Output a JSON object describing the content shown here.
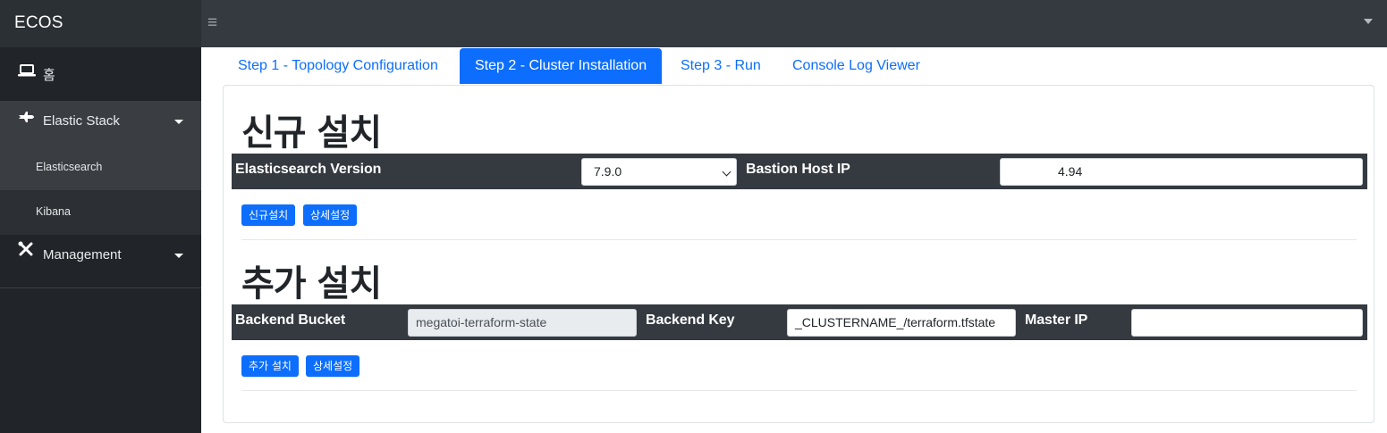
{
  "topbar": {
    "brand": "ECOS",
    "menu_icon": "hamburger-icon",
    "user_menu_icon": "caret-down-icon"
  },
  "sidebar": {
    "items": [
      {
        "label": "홈",
        "icon": "laptop-icon"
      },
      {
        "label": "Elastic Stack",
        "icon": "jet-icon",
        "expanded": true
      },
      {
        "label": "Elasticsearch",
        "icon": "",
        "active": true
      },
      {
        "label": "Kibana",
        "icon": ""
      },
      {
        "label": "Management",
        "icon": "tools-icon"
      }
    ]
  },
  "tabs": [
    {
      "label": "Step 1 - Topology Configuration",
      "active": false
    },
    {
      "label": "Step 2 - Cluster Installation",
      "active": true
    },
    {
      "label": "Step 3 - Run",
      "active": false
    },
    {
      "label": "Console Log Viewer",
      "active": false
    }
  ],
  "new_install": {
    "title": "신규 설치",
    "version_label": "Elasticsearch Version",
    "version_value": "7.9.0",
    "bastion_label": "Bastion Host IP",
    "bastion_value": "4.94",
    "install_button": "신규설치",
    "detail_button": "상세설정"
  },
  "add_install": {
    "title": "추가 설치",
    "bucket_label": "Backend Bucket",
    "bucket_value": "megatoi-terraform-state",
    "key_label": "Backend Key",
    "key_value": "_CLUSTERNAME_/terraform.tfstate",
    "master_label": "Master IP",
    "master_value": "",
    "install_button": "추가 설치",
    "detail_button": "상세설정"
  },
  "colors": {
    "primary": "#0d6efd",
    "topbar": "#343a40",
    "sidebar": "#212529",
    "row": "#343a40"
  }
}
